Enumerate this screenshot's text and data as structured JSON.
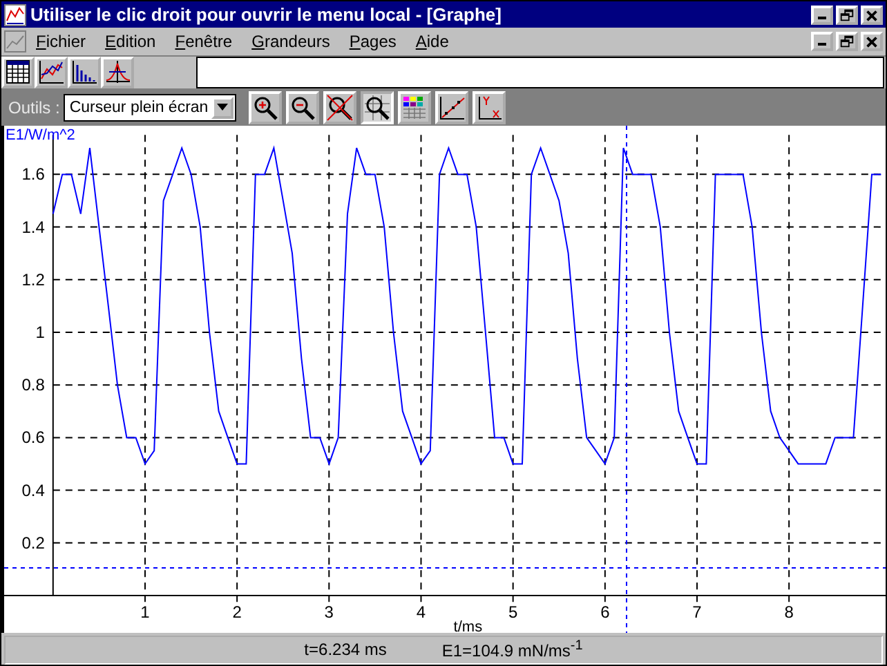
{
  "window": {
    "title": "Utiliser le clic droit pour ouvrir le menu local - [Graphe]"
  },
  "menu": [
    "Fichier",
    "Edition",
    "Fenêtre",
    "Grandeurs",
    "Pages",
    "Aide"
  ],
  "views": [
    {
      "kind": "table"
    },
    {
      "kind": "line"
    },
    {
      "kind": "bars"
    },
    {
      "kind": "peak"
    }
  ],
  "tools": {
    "label": "Outils :",
    "cursor_mode": {
      "value": "Curseur plein écran"
    },
    "buttons": [
      {
        "kind": "zoom-in",
        "selected": false
      },
      {
        "kind": "zoom-out",
        "selected": false
      },
      {
        "kind": "zoom-cancel",
        "selected": false
      },
      {
        "kind": "zoom-grid",
        "selected": true
      },
      {
        "kind": "colors",
        "selected": false
      },
      {
        "kind": "fit-line",
        "selected": false
      },
      {
        "kind": "axes",
        "selected": false
      }
    ]
  },
  "graph": {
    "chart_data": {
      "type": "line",
      "xlabel": "t/ms",
      "ylabel": "E1/W/m^2",
      "xlim": [
        0,
        9.02
      ],
      "ylim": [
        0,
        1.75
      ],
      "grid": true,
      "xticks": [
        1,
        2,
        3,
        4,
        5,
        6,
        7,
        8
      ],
      "yticks": [
        0.2,
        0.4,
        0.6,
        0.8,
        {
          "value": 1,
          "label": "1"
        },
        1.2,
        1.4,
        1.6
      ],
      "x": [
        0,
        0.1,
        0.2,
        0.3,
        0.4,
        0.5,
        0.6,
        0.7,
        0.8,
        0.9,
        1,
        1.1,
        1.2,
        1.3,
        1.4,
        1.5,
        1.6,
        1.7,
        1.8,
        1.9,
        2,
        2.1,
        2.2,
        2.3,
        2.4,
        2.5,
        2.6,
        2.7,
        2.8,
        2.9,
        3,
        3.1,
        3.2,
        3.3,
        3.4,
        3.5,
        3.6,
        3.7,
        3.8,
        3.9,
        4,
        4.1,
        4.2,
        4.3,
        4.4,
        4.5,
        4.6,
        4.7,
        4.8,
        4.9,
        5,
        5.1,
        5.2,
        5.3,
        5.4,
        5.5,
        5.6,
        5.7,
        5.8,
        5.9,
        6,
        6.1,
        6.2,
        6.3,
        6.4,
        6.5,
        6.6,
        6.7,
        6.8,
        6.9,
        7,
        7.1,
        7.2,
        7.3,
        7.4,
        7.5,
        7.6,
        7.7,
        7.8,
        7.9,
        8,
        8.1,
        8.2,
        8.3,
        8.4,
        8.5,
        8.6,
        8.7,
        8.8,
        8.9,
        9
      ],
      "series": [
        {
          "color": "#0000ff",
          "values": [
            1.45,
            1.6,
            1.6,
            1.45,
            1.7,
            1.4,
            1.1,
            0.8,
            0.6,
            0.6,
            0.5,
            0.55,
            1.5,
            1.6,
            1.7,
            1.6,
            1.4,
            1.0,
            0.7,
            0.6,
            0.5,
            0.5,
            1.6,
            1.6,
            1.7,
            1.5,
            1.3,
            0.9,
            0.6,
            0.6,
            0.5,
            0.6,
            1.45,
            1.7,
            1.6,
            1.6,
            1.4,
            1.0,
            0.7,
            0.6,
            0.5,
            0.55,
            1.6,
            1.7,
            1.6,
            1.6,
            1.4,
            1.0,
            0.6,
            0.6,
            0.5,
            0.5,
            1.6,
            1.7,
            1.6,
            1.5,
            1.3,
            0.9,
            0.6,
            0.55,
            0.5,
            0.6,
            1.7,
            1.6,
            1.6,
            1.6,
            1.4,
            1.0,
            0.7,
            0.6,
            0.5,
            0.5,
            1.6,
            1.6,
            1.6,
            1.6,
            1.4,
            1.0,
            0.7,
            0.6,
            0.55,
            0.5,
            0.5,
            0.5,
            0.5,
            0.6,
            0.6,
            0.6,
            1.1,
            1.6,
            1.6
          ]
        }
      ],
      "ref_lines": [
        {
          "axis": "x",
          "value": 6.234
        },
        {
          "axis": "y",
          "value": 0.1049
        }
      ]
    }
  },
  "status_bar": [
    "t=6.234 ms",
    "E1=104.9 mN/ms$^{-1}$"
  ]
}
